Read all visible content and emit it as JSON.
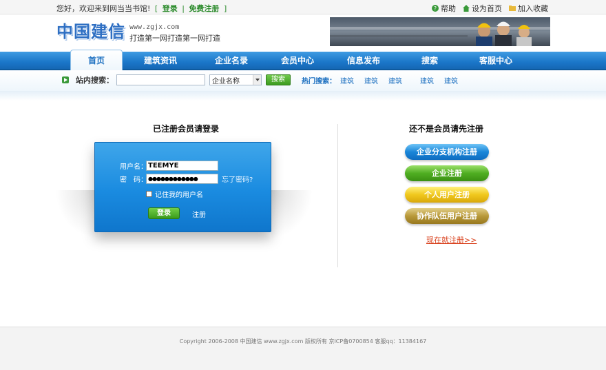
{
  "topbar": {
    "greeting": "您好，欢迎来到网当当书馆!",
    "login": "登录",
    "register": "免费注册",
    "help": "帮助",
    "set_home": "设为首页",
    "bookmark": "加入收藏"
  },
  "header": {
    "logo_text": "中国建信",
    "url": "www.zgjx.com",
    "slogan": "打造第一网打造第一网打造"
  },
  "nav": {
    "items": [
      "首页",
      "建筑资讯",
      "企业名录",
      "会员中心",
      "信息发布",
      "搜索",
      "客服中心"
    ]
  },
  "search": {
    "label": "站内搜索：",
    "input_value": "",
    "select_value": "企业名称",
    "button": "搜索",
    "hot_label": "热门搜索：",
    "hot_words": [
      "建筑",
      "建筑",
      "建筑",
      "建筑",
      "建筑"
    ]
  },
  "login": {
    "title": "已注册会员请登录",
    "username_label": "用户名：",
    "username_value": "TEEMYE",
    "password_label": "密　码：",
    "password_value": "●●●●●●●●●●●●",
    "forgot": "忘了密码?",
    "remember": "记住我的用户名",
    "submit": "登录",
    "register": "注册"
  },
  "signup": {
    "title": "还不是会员请先注册",
    "buttons": [
      "企业分支机构注册",
      "企业注册",
      "个人用户注册",
      "协作队伍用户注册"
    ],
    "now_link": "现在就注册>>"
  },
  "footer": {
    "text": "Copyright 2006-2008 中国建信 www.zgjx.com 版权所有 京ICP备0700854 客服qq：11384167"
  },
  "colors": {
    "nav_blue": "#1b77c9",
    "accent_green": "#3c9a1f",
    "link_orange": "#d9421e"
  }
}
